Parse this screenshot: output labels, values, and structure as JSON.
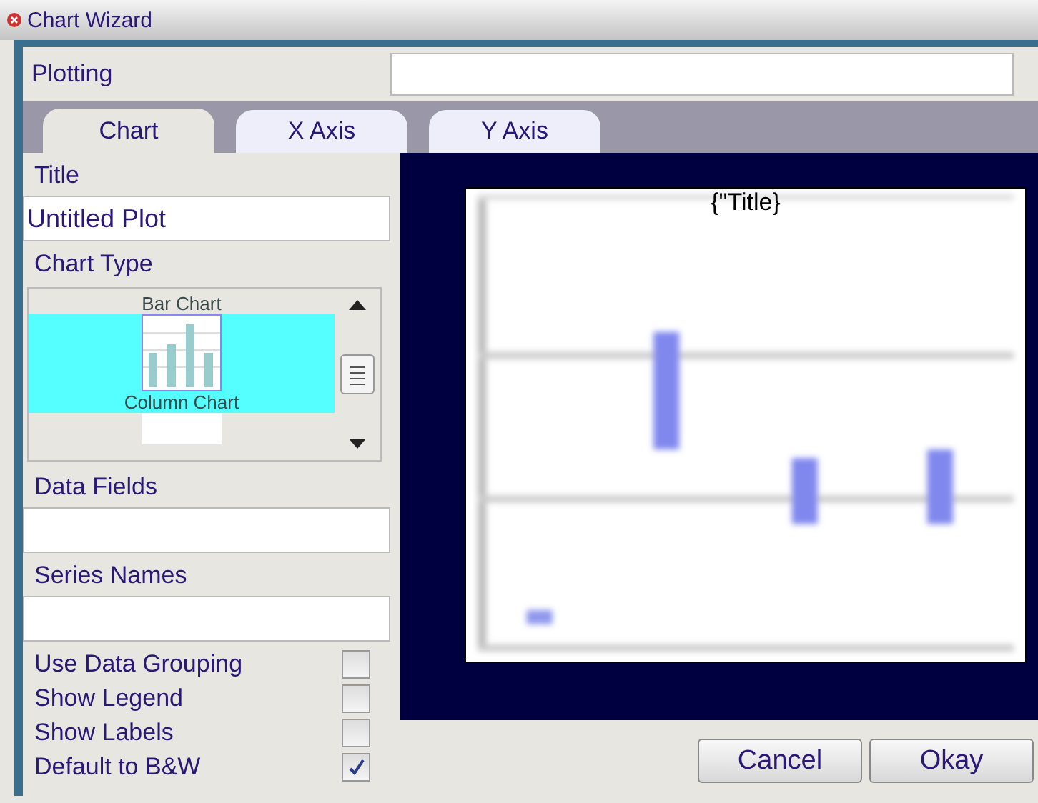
{
  "window": {
    "title": "Chart Wizard"
  },
  "plotting": {
    "label": "Plotting"
  },
  "tabs": [
    {
      "label": "Chart",
      "selected": true
    },
    {
      "label": "X Axis",
      "selected": false
    },
    {
      "label": "Y Axis",
      "selected": false
    }
  ],
  "title_field": {
    "label": "Title",
    "value": "Untitled Plot"
  },
  "chart_type": {
    "label": "Chart Type",
    "items": [
      {
        "label": "Bar Chart",
        "selected": false,
        "kind": "label"
      },
      {
        "label": "Column Chart",
        "selected": true,
        "kind": "full"
      },
      {
        "selected": false,
        "kind": "icon"
      }
    ]
  },
  "data_fields": {
    "label": "Data Fields"
  },
  "series_names": {
    "label": "Series Names"
  },
  "options": [
    {
      "label": "Use Data Grouping",
      "checked": false
    },
    {
      "label": "Show Legend",
      "checked": false
    },
    {
      "label": "Show Labels",
      "checked": false
    },
    {
      "label": "Default to B&W",
      "checked": true
    }
  ],
  "preview": {
    "title": "{\"Title}"
  },
  "buttons": [
    {
      "label": "Cancel"
    },
    {
      "label": "Okay"
    }
  ]
}
